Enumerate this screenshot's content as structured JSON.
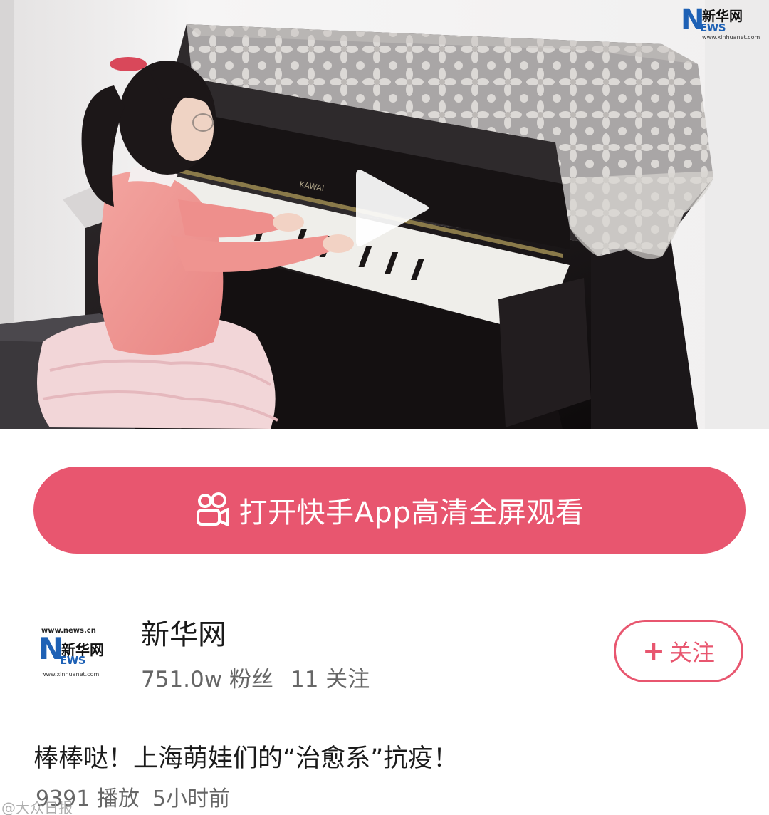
{
  "video": {
    "watermark": {
      "letter": "N",
      "sub": "EWS",
      "brand_cn": "新华网",
      "url": "www.xinhuanet.com"
    },
    "piano_brand": "KAWAI"
  },
  "open_app_button": {
    "label": "打开快手App高清全屏观看"
  },
  "author": {
    "avatar": {
      "url_top": "www.news.cn",
      "letter": "N",
      "sub": "EWS",
      "brand_cn": "新华网",
      "url_bottom": "www.xinhuanet.com"
    },
    "name": "新华网",
    "followers": "751.0w 粉丝",
    "following": "11 关注",
    "follow_label": "关注",
    "follow_plus": "+"
  },
  "post": {
    "caption": "棒棒哒！上海萌娃们的“治愈系”抗疫！",
    "plays": "9391 播放",
    "time_ago": "5小时前"
  },
  "bottom_watermark": "@大众日报",
  "colors": {
    "accent": "#e8566f",
    "brand_blue": "#1e61b5",
    "text_primary": "#1a1a1a",
    "text_secondary": "#666666"
  }
}
